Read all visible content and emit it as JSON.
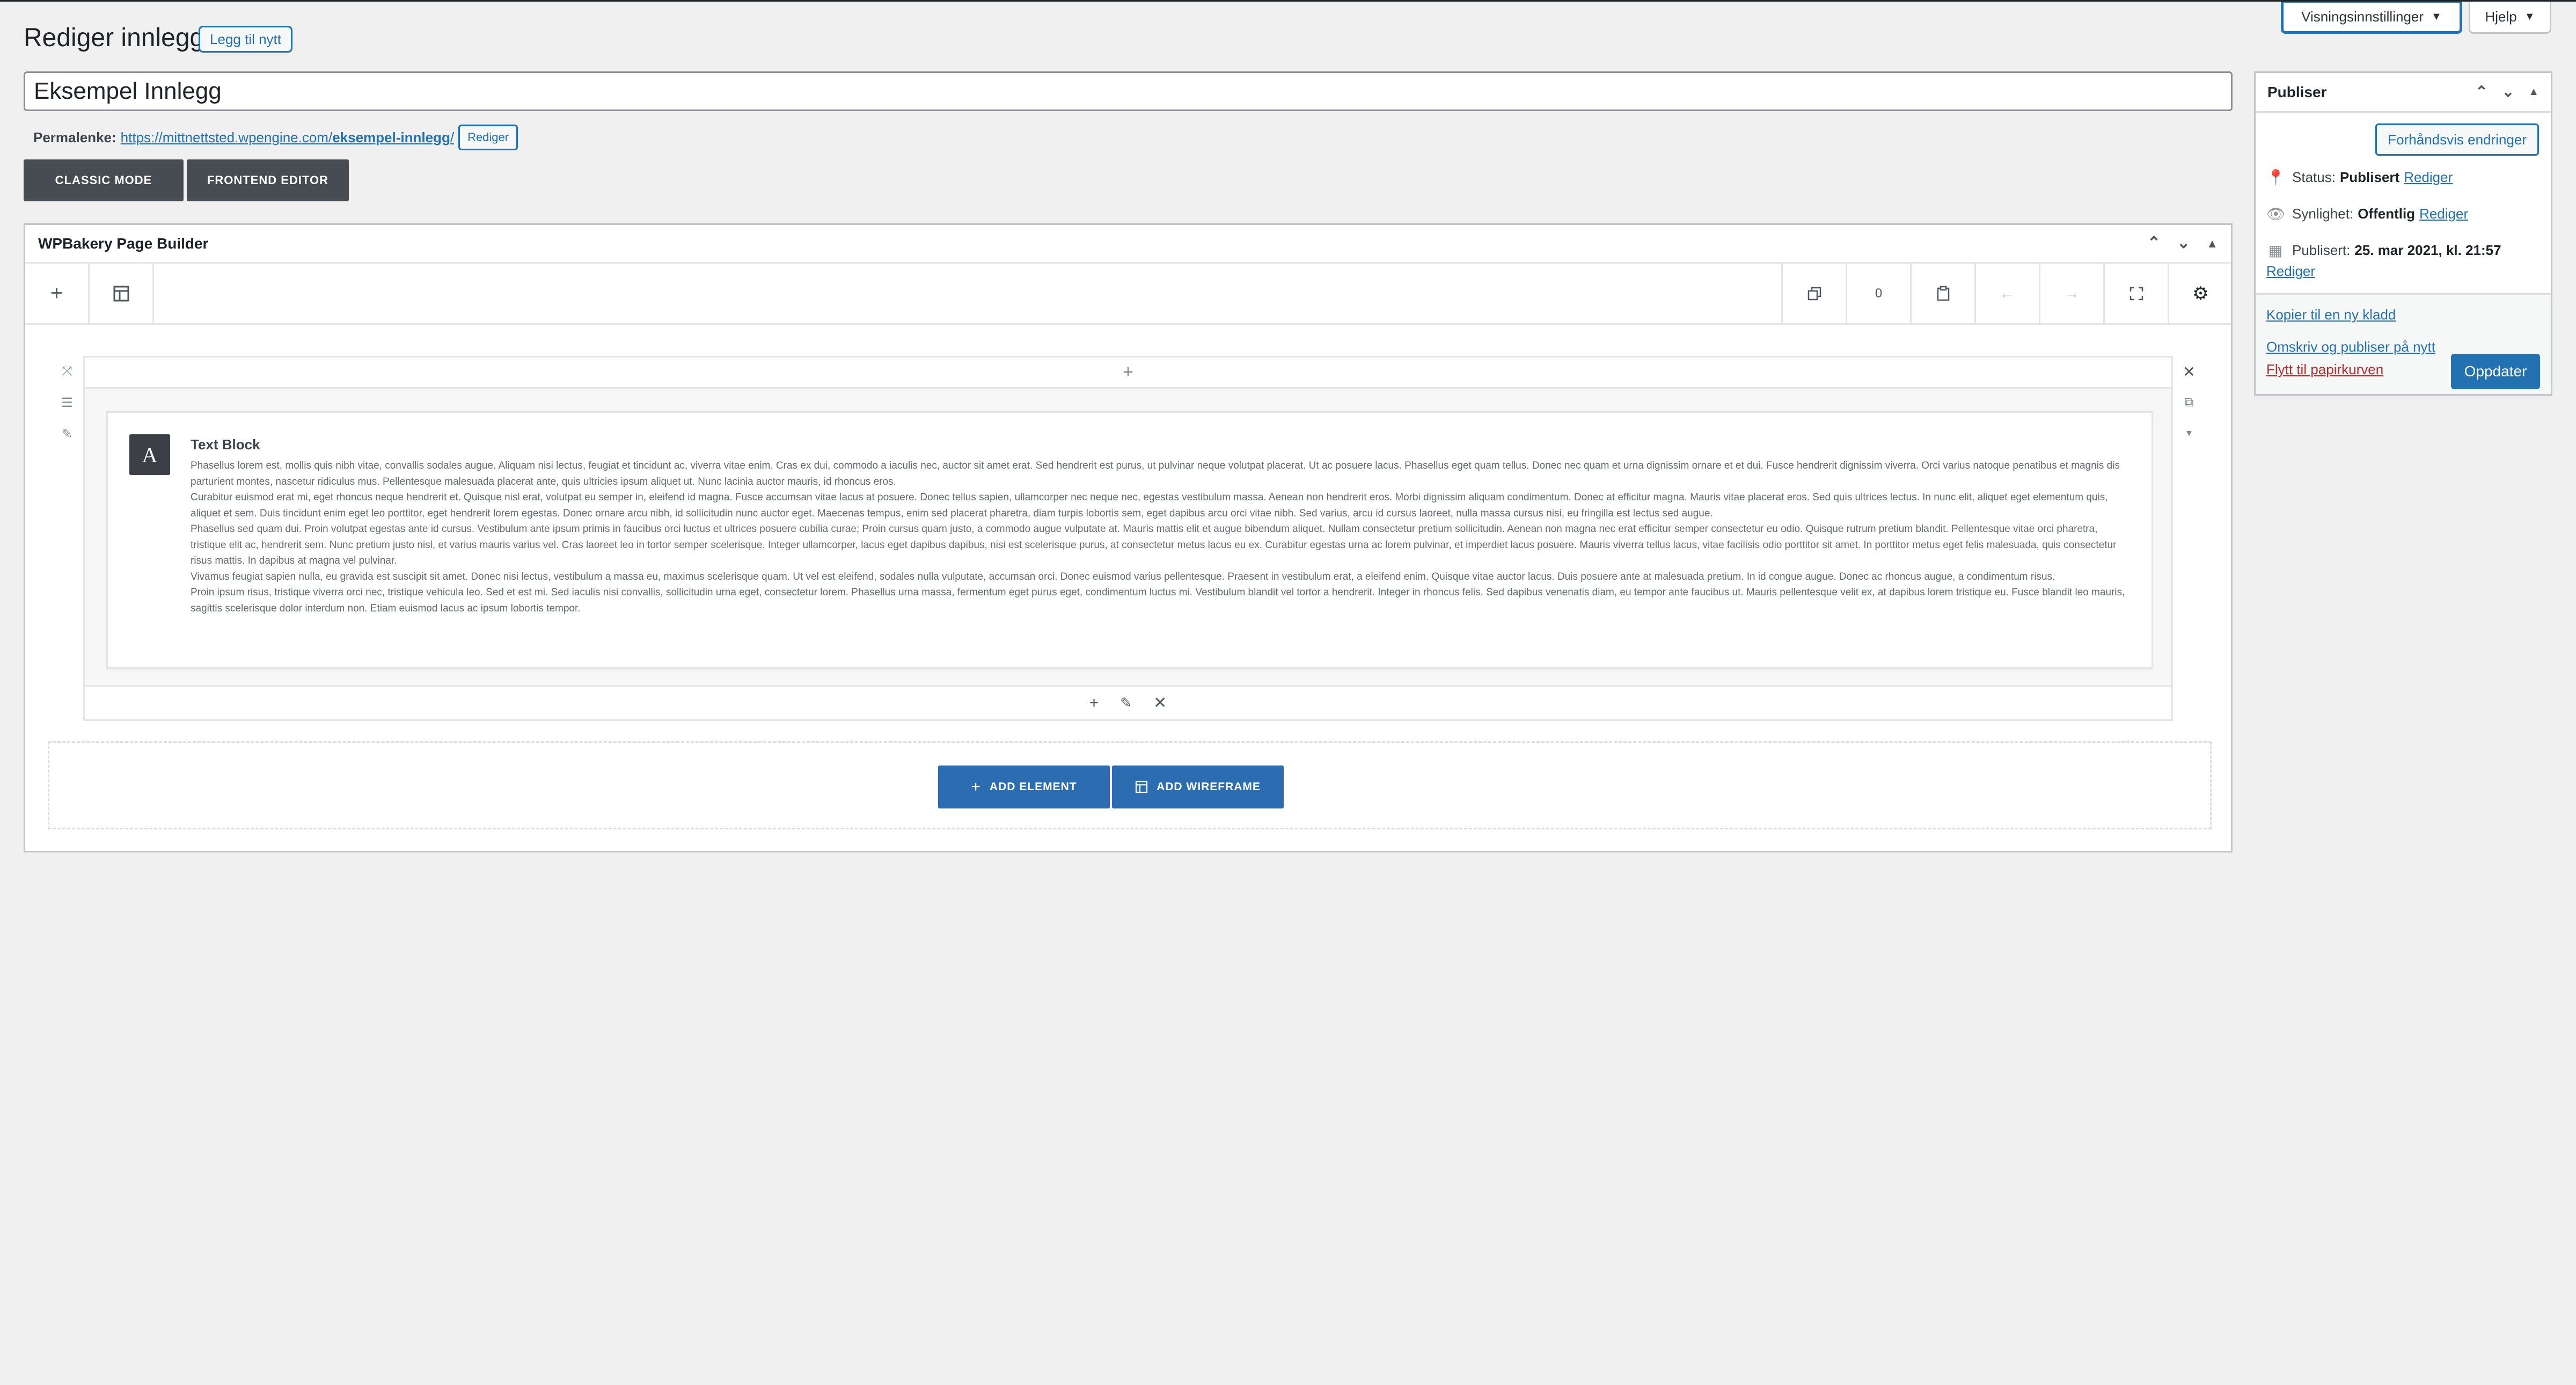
{
  "screen_meta": {
    "options_label": "Visningsinnstillinger",
    "help_label": "Hjelp"
  },
  "header": {
    "title": "Rediger innlegg",
    "add_new_label": "Legg til nytt"
  },
  "post": {
    "title_value": "Eksempel Innlegg",
    "permalink_label": "Permalenke:",
    "permalink_base": "https://mittnettsted.wpengine.com/",
    "permalink_slug": "eksempel-innlegg",
    "permalink_trailing": "/",
    "permalink_edit_label": "Rediger"
  },
  "modes": {
    "classic_label": "CLASSIC MODE",
    "frontend_label": "FRONTEND EDITOR"
  },
  "wpbakery": {
    "title": "WPBakery Page Builder",
    "history_count": "0",
    "text_block": {
      "icon_letter": "A",
      "title": "Text Block",
      "paragraphs": [
        "Phasellus lorem est, mollis quis nibh vitae, convallis sodales augue. Aliquam nisi lectus, feugiat et tincidunt ac, viverra vitae enim. Cras ex dui, commodo a iaculis nec, auctor sit amet erat. Sed hendrerit est purus, ut pulvinar neque volutpat placerat. Ut ac posuere lacus. Phasellus eget quam tellus. Donec nec quam et urna dignissim ornare et et dui. Fusce hendrerit dignissim viverra. Orci varius natoque penatibus et magnis dis parturient montes, nascetur ridiculus mus. Pellentesque malesuada placerat ante, quis ultricies ipsum aliquet ut. Nunc lacinia auctor mauris, id rhoncus eros.",
        "Curabitur euismod erat mi, eget rhoncus neque hendrerit et. Quisque nisl erat, volutpat eu semper in, eleifend id magna. Fusce accumsan vitae lacus at posuere. Donec tellus sapien, ullamcorper nec neque nec, egestas vestibulum massa. Aenean non hendrerit eros. Morbi dignissim aliquam condimentum. Donec at efficitur magna. Mauris vitae placerat eros. Sed quis ultrices lectus. In nunc elit, aliquet eget elementum quis, aliquet et sem. Duis tincidunt enim eget leo porttitor, eget hendrerit lorem egestas. Donec ornare arcu nibh, id sollicitudin nunc auctor eget. Maecenas tempus, enim sed placerat pharetra, diam turpis lobortis sem, eget dapibus arcu orci vitae nibh. Sed varius, arcu id cursus laoreet, nulla massa cursus nisi, eu fringilla est lectus sed augue.",
        "Phasellus sed quam dui. Proin volutpat egestas ante id cursus. Vestibulum ante ipsum primis in faucibus orci luctus et ultrices posuere cubilia curae; Proin cursus quam justo, a commodo augue vulputate at. Mauris mattis elit et augue bibendum aliquet. Nullam consectetur pretium sollicitudin. Aenean non magna nec erat efficitur semper consectetur eu odio. Quisque rutrum pretium blandit. Pellentesque vitae orci pharetra, tristique elit ac, hendrerit sem. Nunc pretium justo nisl, et varius mauris varius vel. Cras laoreet leo in tortor semper scelerisque. Integer ullamcorper, lacus eget dapibus dapibus, nisi est scelerisque purus, at consectetur metus lacus eu ex. Curabitur egestas urna ac lorem pulvinar, et imperdiet lacus posuere. Mauris viverra tellus lacus, vitae facilisis odio porttitor sit amet. In porttitor metus eget felis malesuada, quis consectetur risus mattis. In dapibus at magna vel pulvinar.",
        "Vivamus feugiat sapien nulla, eu gravida est suscipit sit amet. Donec nisi lectus, vestibulum a massa eu, maximus scelerisque quam. Ut vel est eleifend, sodales nulla vulputate, accumsan orci. Donec euismod varius pellentesque. Praesent in vestibulum erat, a eleifend enim. Quisque vitae auctor lacus. Duis posuere ante at malesuada pretium. In id congue augue. Donec ac rhoncus augue, a condimentum risus.",
        "Proin ipsum risus, tristique viverra orci nec, tristique vehicula leo. Sed et est mi. Sed iaculis nisi convallis, sollicitudin urna eget, consectetur lorem. Phasellus urna massa, fermentum eget purus eget, condimentum luctus mi. Vestibulum blandit vel tortor a hendrerit. Integer in rhoncus felis. Sed dapibus venenatis diam, eu tempor ante faucibus ut. Mauris pellentesque velit ex, at dapibus lorem tristique eu. Fusce blandit leo mauris, sagittis scelerisque dolor interdum non. Etiam euismod lacus ac ipsum lobortis tempor."
      ]
    },
    "add_element_label": "ADD ELEMENT",
    "add_wireframe_label": "ADD WIREFRAME"
  },
  "publish": {
    "title": "Publiser",
    "preview_label": "Forhåndsvis endringer",
    "status_label": "Status:",
    "status_value": "Publisert",
    "visibility_label": "Synlighet:",
    "visibility_value": "Offentlig",
    "published_label": "Publisert:",
    "published_value": "25. mar 2021, kl. 21:57",
    "edit_label": "Rediger",
    "copy_draft_label": "Kopier til en ny kladd",
    "rewrite_label": "Omskriv og publiser på nytt",
    "trash_label": "Flytt til papirkurven",
    "update_label": "Oppdater"
  },
  "colors": {
    "primary": "#2271b1",
    "dark_button": "#474c52",
    "danger": "#b32d2e"
  }
}
